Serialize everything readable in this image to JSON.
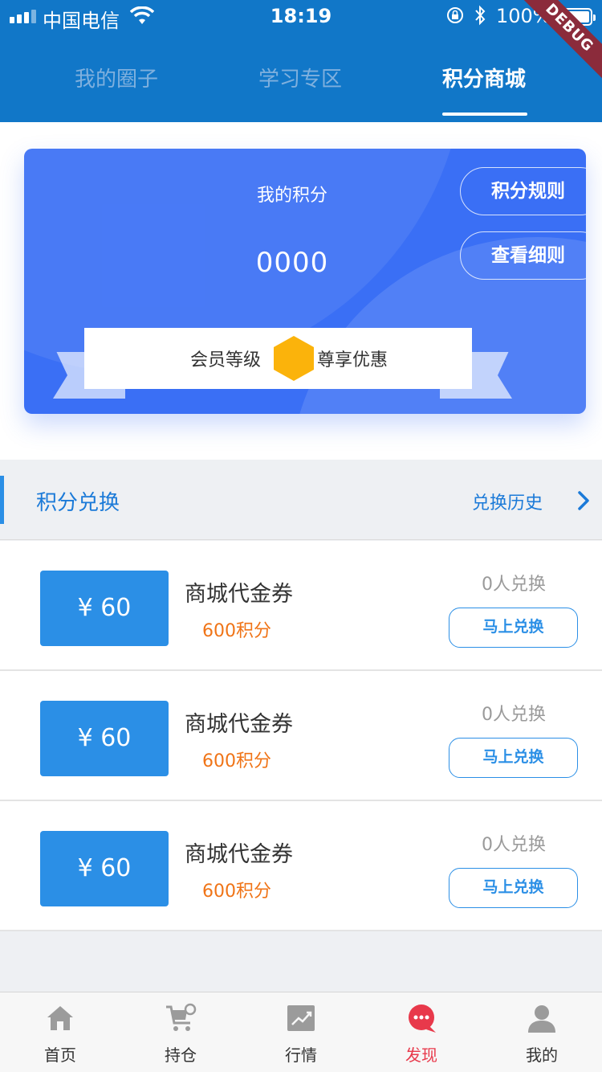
{
  "status_bar": {
    "carrier": "中国电信",
    "time": "18:19",
    "battery": "100%",
    "icons": [
      "signal-icon",
      "wifi-icon",
      "orientation-lock-icon",
      "bluetooth-icon",
      "battery-icon"
    ]
  },
  "debug_banner": "DEBUG",
  "tabs": [
    {
      "label": "我的圈子",
      "active": false
    },
    {
      "label": "学习专区",
      "active": false
    },
    {
      "label": "积分商城",
      "active": true
    }
  ],
  "points_card": {
    "label": "我的积分",
    "value": "0000",
    "rules_button": "积分规则",
    "details_button": "查看细则",
    "member_level_label": "会员等级",
    "benefit_label": "尊享优惠"
  },
  "exchange_section": {
    "title": "积分兑换",
    "history_link": "兑换历史"
  },
  "items": [
    {
      "coupon": "¥ 60",
      "name": "商城代金券",
      "points": "600积分",
      "count": "0人兑换",
      "button": "马上兑换"
    },
    {
      "coupon": "¥ 60",
      "name": "商城代金券",
      "points": "600积分",
      "count": "0人兑换",
      "button": "马上兑换"
    },
    {
      "coupon": "¥ 60",
      "name": "商城代金券",
      "points": "600积分",
      "count": "0人兑换",
      "button": "马上兑换"
    }
  ],
  "bottom_nav": [
    {
      "label": "首页",
      "icon": "home-icon",
      "active": false
    },
    {
      "label": "持仓",
      "icon": "cart-icon",
      "active": false
    },
    {
      "label": "行情",
      "icon": "chart-icon",
      "active": false
    },
    {
      "label": "发现",
      "icon": "discover-chat-icon",
      "active": true
    },
    {
      "label": "我的",
      "icon": "profile-icon",
      "active": false
    }
  ],
  "colors": {
    "header_bg": "#1177c8",
    "card_bg": "#3a6ff5",
    "accent_blue": "#2b8fe6",
    "points_orange": "#f07417",
    "active_nav_red": "#e8394b",
    "level_badge": "#fbb30b"
  }
}
